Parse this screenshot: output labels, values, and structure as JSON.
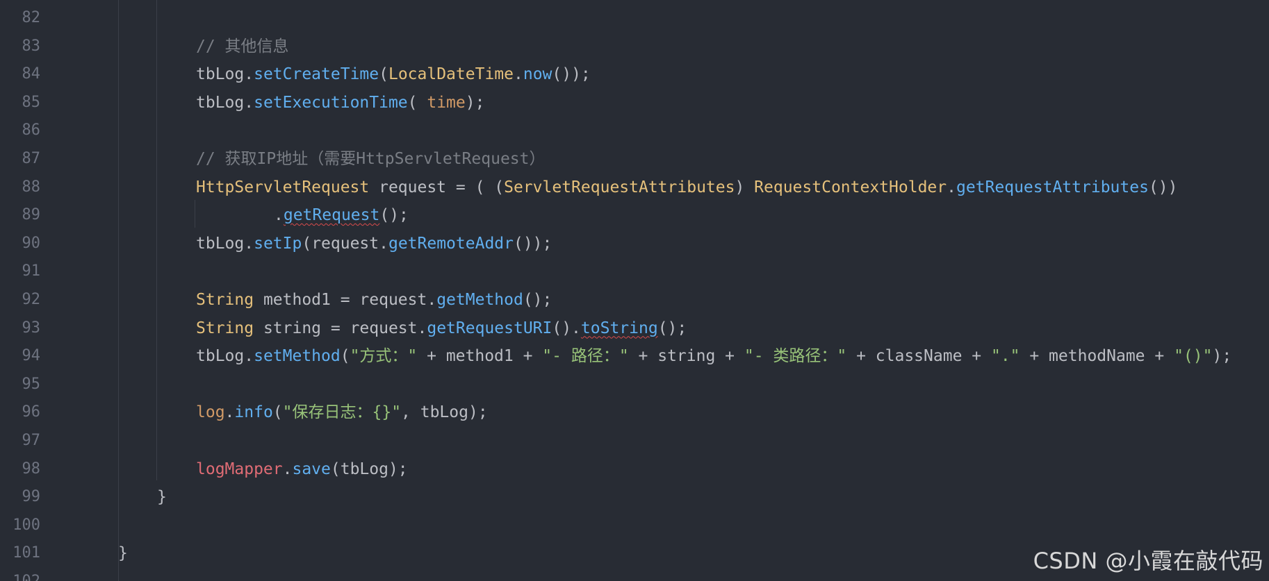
{
  "editor": {
    "lines": [
      {
        "num": "82",
        "tokens": []
      },
      {
        "num": "83",
        "indent": 2,
        "tokens": [
          {
            "t": "// 其他信息",
            "c": "comment"
          }
        ]
      },
      {
        "num": "84",
        "indent": 2,
        "tokens": [
          {
            "t": "tbLog.",
            "c": "plain"
          },
          {
            "t": "setCreateTime",
            "c": "method"
          },
          {
            "t": "(",
            "c": "plain"
          },
          {
            "t": "LocalDateTime",
            "c": "type"
          },
          {
            "t": ".",
            "c": "plain"
          },
          {
            "t": "now",
            "c": "method"
          },
          {
            "t": "());",
            "c": "plain"
          }
        ]
      },
      {
        "num": "85",
        "indent": 2,
        "tokens": [
          {
            "t": "tbLog.",
            "c": "plain"
          },
          {
            "t": "setExecutionTime",
            "c": "method"
          },
          {
            "t": "( ",
            "c": "plain"
          },
          {
            "t": "time",
            "c": "param"
          },
          {
            "t": ");",
            "c": "plain"
          }
        ]
      },
      {
        "num": "86",
        "tokens": []
      },
      {
        "num": "87",
        "indent": 2,
        "tokens": [
          {
            "t": "// 获取IP地址（需要HttpServletRequest）",
            "c": "comment"
          }
        ]
      },
      {
        "num": "88",
        "indent": 2,
        "tokens": [
          {
            "t": "HttpServletRequest",
            "c": "type"
          },
          {
            "t": " request = ( (",
            "c": "plain"
          },
          {
            "t": "ServletRequestAttributes",
            "c": "type"
          },
          {
            "t": ") ",
            "c": "plain"
          },
          {
            "t": "RequestContextHolder",
            "c": "type"
          },
          {
            "t": ".",
            "c": "plain"
          },
          {
            "t": "getRequestAttributes",
            "c": "method"
          },
          {
            "t": "())",
            "c": "plain"
          }
        ]
      },
      {
        "num": "89",
        "indent": 4,
        "tokens": [
          {
            "t": ".",
            "c": "plain"
          },
          {
            "t": "getRequest",
            "c": "method",
            "squiggle": true
          },
          {
            "t": "();",
            "c": "plain"
          }
        ]
      },
      {
        "num": "90",
        "indent": 2,
        "tokens": [
          {
            "t": "tbLog.",
            "c": "plain"
          },
          {
            "t": "setIp",
            "c": "method"
          },
          {
            "t": "(request.",
            "c": "plain"
          },
          {
            "t": "getRemoteAddr",
            "c": "method"
          },
          {
            "t": "());",
            "c": "plain"
          }
        ]
      },
      {
        "num": "91",
        "tokens": []
      },
      {
        "num": "92",
        "indent": 2,
        "tokens": [
          {
            "t": "String",
            "c": "type"
          },
          {
            "t": " method1 = request.",
            "c": "plain"
          },
          {
            "t": "getMethod",
            "c": "method"
          },
          {
            "t": "();",
            "c": "plain"
          }
        ]
      },
      {
        "num": "93",
        "indent": 2,
        "tokens": [
          {
            "t": "String",
            "c": "type"
          },
          {
            "t": " string = request.",
            "c": "plain"
          },
          {
            "t": "getRequestURI",
            "c": "method"
          },
          {
            "t": "().",
            "c": "plain"
          },
          {
            "t": "toString",
            "c": "method",
            "squiggle": true
          },
          {
            "t": "();",
            "c": "plain"
          }
        ]
      },
      {
        "num": "94",
        "indent": 2,
        "tokens": [
          {
            "t": "tbLog.",
            "c": "plain"
          },
          {
            "t": "setMethod",
            "c": "method"
          },
          {
            "t": "(",
            "c": "plain"
          },
          {
            "t": "\"方式：\"",
            "c": "string"
          },
          {
            "t": " + method1 + ",
            "c": "plain"
          },
          {
            "t": "\"- 路径：\"",
            "c": "string"
          },
          {
            "t": " + string + ",
            "c": "plain"
          },
          {
            "t": "\"- 类路径：\"",
            "c": "string"
          },
          {
            "t": " + className + ",
            "c": "plain"
          },
          {
            "t": "\".\"",
            "c": "string"
          },
          {
            "t": " + methodName + ",
            "c": "plain"
          },
          {
            "t": "\"()\"",
            "c": "string"
          },
          {
            "t": ");",
            "c": "plain"
          }
        ]
      },
      {
        "num": "95",
        "tokens": []
      },
      {
        "num": "96",
        "indent": 2,
        "tokens": [
          {
            "t": "log",
            "c": "param"
          },
          {
            "t": ".",
            "c": "plain"
          },
          {
            "t": "info",
            "c": "method"
          },
          {
            "t": "(",
            "c": "plain"
          },
          {
            "t": "\"保存日志：{}\"",
            "c": "string"
          },
          {
            "t": ", tbLog);",
            "c": "plain"
          }
        ]
      },
      {
        "num": "97",
        "tokens": []
      },
      {
        "num": "98",
        "indent": 2,
        "tokens": [
          {
            "t": "logMapper",
            "c": "field"
          },
          {
            "t": ".",
            "c": "plain"
          },
          {
            "t": "save",
            "c": "method"
          },
          {
            "t": "(tbLog);",
            "c": "plain"
          }
        ]
      },
      {
        "num": "99",
        "indent": 1,
        "tokens": [
          {
            "t": "}",
            "c": "plain"
          }
        ]
      },
      {
        "num": "100",
        "tokens": []
      },
      {
        "num": "101",
        "indent": 0,
        "tokens": [
          {
            "t": "}",
            "c": "plain"
          }
        ]
      },
      {
        "num": "102",
        "tokens": []
      }
    ]
  },
  "watermark": "CSDN @小霞在敲代码"
}
